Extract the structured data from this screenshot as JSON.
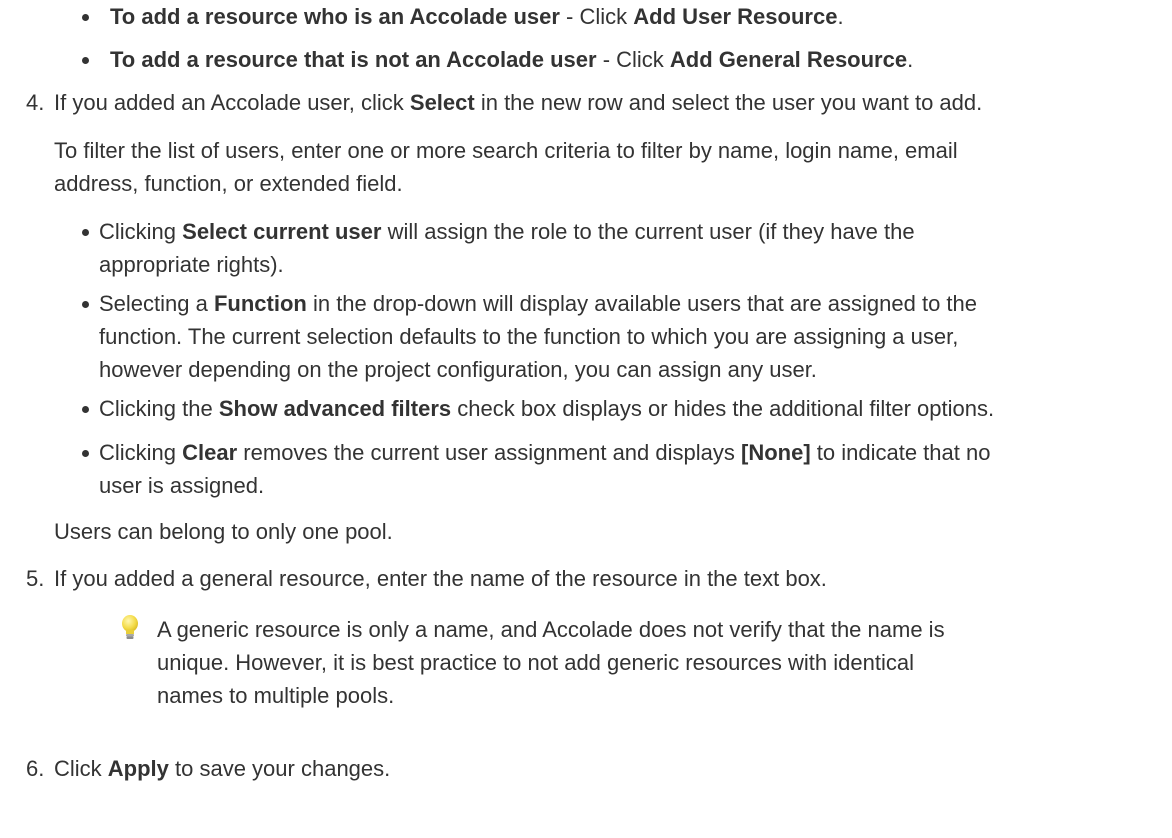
{
  "substeps_top": [
    {
      "bold": "To add a resource who is an Accolade user",
      "sep": " - Click ",
      "bold2": "Add User Resource",
      "end": "."
    },
    {
      "bold": "To add a resource that is not an Accolade user",
      "sep": " - Click ",
      "bold2": "Add General Resource",
      "end": "."
    }
  ],
  "step4": {
    "number": "4.",
    "pre": "If you added an Accolade user, click ",
    "bold": "Select",
    "post": " in the new row and select the user you want to add.",
    "filter_line1": "To filter the list of users, enter one or more search criteria to filter by name, login name, email",
    "filter_line2": "address, function, or extended field.",
    "bullets": [
      {
        "pre": "Clicking ",
        "bold": "Select current user",
        "post": " will assign the role to the current user (if they have the",
        "line2": "appropriate rights)."
      },
      {
        "pre": "Selecting a ",
        "bold": "Function",
        "post": " in the drop-down will display available users that are assigned to the",
        "line2": "function. The current selection defaults to the function to which you are assigning a user,",
        "line3": "however depending on the project configuration, you can assign any user."
      },
      {
        "pre": "Clicking the ",
        "bold": "Show advanced filters",
        "post": " check box displays or hides the additional filter options."
      },
      {
        "pre": "Clicking ",
        "bold": "Clear",
        "mid": " removes the current user assignment and displays ",
        "bold2": "[None]",
        "post": " to indicate that no",
        "line2": "user is assigned."
      }
    ],
    "pool_note": "Users can belong to only one pool."
  },
  "step5": {
    "number": "5.",
    "text": "If you added a general resource, enter the name of the resource in the text box.",
    "tip_line1": "A generic resource is only a name, and Accolade does not verify that the name is",
    "tip_line2": "unique. However, it is best practice to not add generic resources with identical",
    "tip_line3": "names to multiple pools.",
    "tip_icon": "lightbulb-icon"
  },
  "step6": {
    "number": "6.",
    "pre": "Click ",
    "bold": "Apply",
    "post": " to save your changes."
  },
  "colors": {
    "text": "#333333",
    "bulb": "#f2d640"
  }
}
